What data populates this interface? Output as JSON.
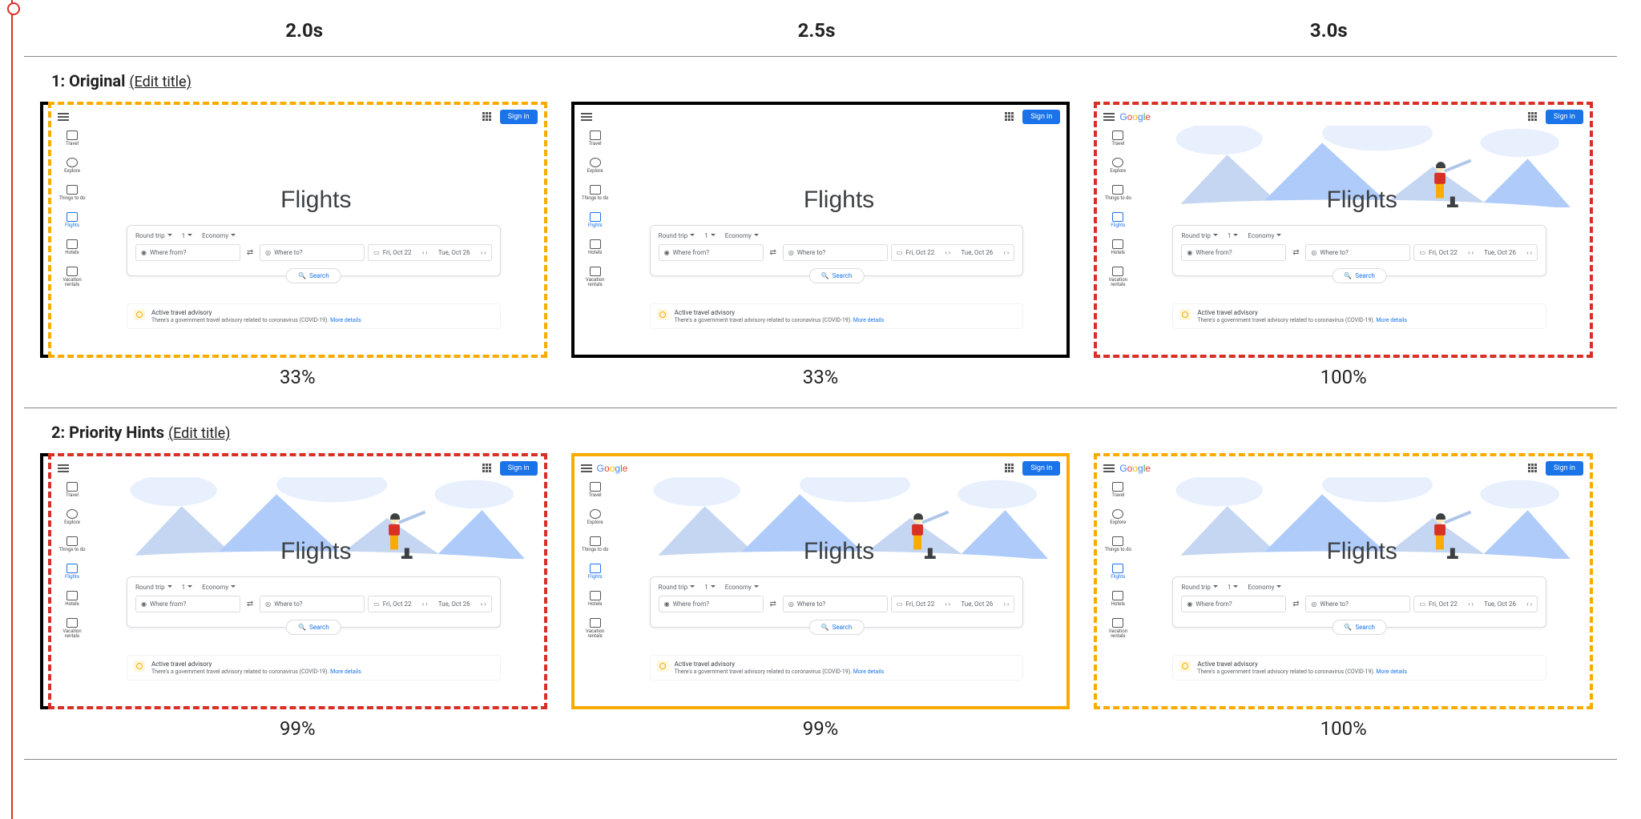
{
  "time_header": {
    "t0": "2.0s",
    "t1": "2.5s",
    "t2": "3.0s"
  },
  "groups": [
    {
      "id": 1,
      "title": "1: Original",
      "edit": "(Edit title)",
      "frames": [
        {
          "border": "b-dash-orange",
          "pct": "33%",
          "show_bracket": true,
          "show_hero": false,
          "show_logo": false
        },
        {
          "border": "b-solid-black",
          "pct": "33%",
          "show_bracket": false,
          "show_hero": false,
          "show_logo": false
        },
        {
          "border": "b-dash-red",
          "pct": "100%",
          "show_bracket": false,
          "show_hero": true,
          "show_logo": true
        }
      ]
    },
    {
      "id": 2,
      "title": "2: Priority Hints",
      "edit": "(Edit title)",
      "frames": [
        {
          "border": "b-dash-red",
          "pct": "99%",
          "show_bracket": true,
          "show_hero": true,
          "show_logo": false
        },
        {
          "border": "b-solid-orange",
          "pct": "99%",
          "show_bracket": false,
          "show_hero": true,
          "show_logo": true
        },
        {
          "border": "b-dash-orange",
          "pct": "100%",
          "show_bracket": false,
          "show_hero": true,
          "show_logo": true
        }
      ]
    }
  ],
  "flights_mock": {
    "title": "Flights",
    "signin": "Sign in",
    "logo": "Google",
    "sidebar": [
      {
        "label": "Travel"
      },
      {
        "label": "Explore"
      },
      {
        "label": "Things to do"
      },
      {
        "label": "Flights",
        "active": true
      },
      {
        "label": "Hotels"
      },
      {
        "label": "Vacation rentals"
      }
    ],
    "chips": {
      "trip": "Round trip",
      "pax": "1",
      "class": "Economy"
    },
    "from_placeholder": "Where from?",
    "to_placeholder": "Where to?",
    "date_out": "Fri, Oct 22",
    "date_ret": "Tue, Oct 26",
    "search": "Search",
    "advisory_title": "Active travel advisory",
    "advisory_sub": "There's a government travel advisory related to coronavirus (COVID-19).",
    "advisory_link": "More details"
  }
}
